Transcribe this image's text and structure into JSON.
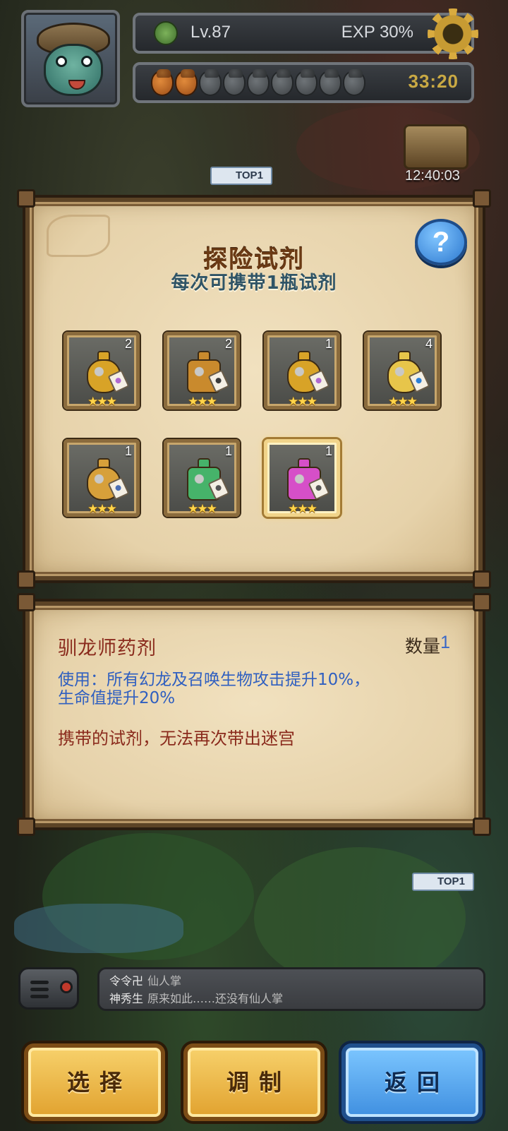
{
  "hud": {
    "level": "Lv.87",
    "exp": "EXP 30%",
    "stamina": {
      "filled": 2,
      "total": 9
    },
    "stamina_timer": "33:20",
    "chest_timer": "12:40:03",
    "top_flag": "TOP1"
  },
  "potion_panel": {
    "title": "探险试剂",
    "subtitle": "每次可携带1瓶试剂",
    "help_label": "?",
    "items": [
      {
        "count": "2",
        "stars": "★★★",
        "shape": "round",
        "color": "#d8a327",
        "tag_color": "#b06ad0"
      },
      {
        "count": "2",
        "stars": "★★★",
        "shape": "square",
        "color": "#c98a2d",
        "tag_color": "#3b3b3b"
      },
      {
        "count": "1",
        "stars": "★★★",
        "shape": "round",
        "color": "#d8a327",
        "tag_color": "#b06ad0"
      },
      {
        "count": "4",
        "stars": "★★★",
        "shape": "round",
        "color": "#e7c54a",
        "tag_color": "#2c7fd6"
      },
      {
        "count": "1",
        "stars": "★★★",
        "shape": "round",
        "color": "#d7a03a",
        "tag_color": "#4a6fb5"
      },
      {
        "count": "1",
        "stars": "★★★",
        "shape": "square",
        "color": "#46b36a",
        "tag_color": "#555555"
      },
      {
        "count": "1",
        "stars": "★★★",
        "shape": "square",
        "color": "#d64fc8",
        "tag_color": "#555555",
        "selected": true
      }
    ]
  },
  "detail": {
    "name": "驯龙师药剂",
    "qty_label": "数量",
    "qty_value": "1",
    "effect_line1": "使用：所有幻龙及召唤生物攻击提升10%，",
    "effect_line2": "生命值提升20%",
    "warning": "携带的试剂，无法再次带出迷宫"
  },
  "chat": {
    "messages": [
      {
        "user": "令令卍",
        "text": "仙人掌"
      },
      {
        "user": "神秀生",
        "text": "原来如此……还没有仙人掌"
      }
    ]
  },
  "buttons": {
    "select": "选择",
    "craft": "调制",
    "back": "返回"
  },
  "colors": {
    "gold_button": "#e8b23d",
    "blue_button": "#4f9de8",
    "item_name": "#8a2a1c",
    "effect_text": "#2f5fc0"
  }
}
